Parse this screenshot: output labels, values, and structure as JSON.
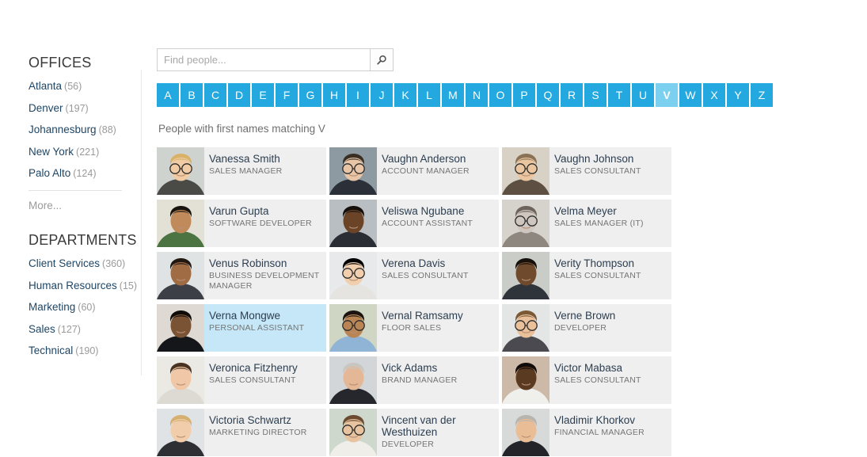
{
  "sidebar": {
    "offices": {
      "heading": "OFFICES",
      "items": [
        {
          "label": "Atlanta",
          "count": "(56)"
        },
        {
          "label": "Denver",
          "count": "(197)"
        },
        {
          "label": "Johannesburg",
          "count": "(88)"
        },
        {
          "label": "New York",
          "count": "(221)"
        },
        {
          "label": "Palo Alto",
          "count": "(124)"
        }
      ],
      "more_label": "More..."
    },
    "departments": {
      "heading": "DEPARTMENTS",
      "items": [
        {
          "label": "Client Services",
          "count": "(360)"
        },
        {
          "label": "Human Resources",
          "count": "(15)"
        },
        {
          "label": "Marketing",
          "count": "(60)"
        },
        {
          "label": "Sales",
          "count": "(127)"
        },
        {
          "label": "Technical",
          "count": "(190)"
        }
      ]
    }
  },
  "search": {
    "placeholder": "Find people...",
    "value": "",
    "icon": "search-icon"
  },
  "alphabet": {
    "letters": [
      "A",
      "B",
      "C",
      "D",
      "E",
      "F",
      "G",
      "H",
      "I",
      "J",
      "K",
      "L",
      "M",
      "N",
      "O",
      "P",
      "Q",
      "R",
      "S",
      "T",
      "U",
      "V",
      "W",
      "X",
      "Y",
      "Z"
    ],
    "active": "V"
  },
  "results": {
    "caption": "People with first names matching V",
    "people": [
      {
        "name": "Vanessa Smith",
        "title": "SALES MANAGER",
        "selected": false,
        "photo": {
          "skin": "#f0cba4",
          "hair": "#d8b268",
          "shirt": "#4a4a46",
          "bg": "#cfd3d0",
          "glasses": true
        }
      },
      {
        "name": "Vaughn Anderson",
        "title": "ACCOUNT MANAGER",
        "selected": false,
        "photo": {
          "skin": "#e8c5a6",
          "hair": "#3a2f25",
          "shirt": "#2b2f38",
          "bg": "#8e9aa2",
          "glasses": true
        }
      },
      {
        "name": "Vaughn Johnson",
        "title": "SALES CONSULTANT",
        "selected": false,
        "photo": {
          "skin": "#eac6a0",
          "hair": "#8a7256",
          "shirt": "#5d5043",
          "bg": "#d8d2c6",
          "glasses": true
        }
      },
      {
        "name": "Varun Gupta",
        "title": "SOFTWARE DEVELOPER",
        "selected": false,
        "photo": {
          "skin": "#c08a5a",
          "hair": "#19130f",
          "shirt": "#4c7342",
          "bg": "#e3e0d6",
          "glasses": false
        }
      },
      {
        "name": "Veliswa Ngubane",
        "title": "ACCOUNT ASSISTANT",
        "selected": false,
        "photo": {
          "skin": "#6b4428",
          "hair": "#16100c",
          "shirt": "#2a2d34",
          "bg": "#b9bec2",
          "glasses": false
        }
      },
      {
        "name": "Velma Meyer",
        "title": "SALES MANAGER (IT)",
        "selected": false,
        "photo": {
          "skin": "#cfc7bf",
          "hair": "#6d655d",
          "shirt": "#8d8780",
          "bg": "#d6d2cc",
          "glasses": true
        }
      },
      {
        "name": "Venus Robinson",
        "title": "BUSINESS DEVELOPMENT MANAGER",
        "selected": false,
        "photo": {
          "skin": "#a06c44",
          "hair": "#221812",
          "shirt": "#3c3f46",
          "bg": "#dfe3e4",
          "glasses": false
        }
      },
      {
        "name": "Verena Davis",
        "title": "SALES CONSULTANT",
        "selected": false,
        "photo": {
          "skin": "#f1cfae",
          "hair": "#cda householder",
          "shirt": "#e6e4e0",
          "bg": "#e7e9ea",
          "glasses": true
        }
      },
      {
        "name": "Verity Thompson",
        "title": "SALES CONSULTANT",
        "selected": false,
        "photo": {
          "skin": "#6f4a2c",
          "hair": "#17110d",
          "shirt": "#2f333a",
          "bg": "#c9ccc7",
          "glasses": false
        }
      },
      {
        "name": "Verna Mongwe",
        "title": "PERSONAL ASSISTANT",
        "selected": true,
        "photo": {
          "skin": "#7a5234",
          "hair": "#100c09",
          "shirt": "#15161a",
          "bg": "#ded9d2",
          "glasses": false
        }
      },
      {
        "name": "Vernal Ramsamy",
        "title": "FLOOR SALES",
        "selected": false,
        "photo": {
          "skin": "#b98555",
          "hair": "#1b1410",
          "shirt": "#8fb4d6",
          "bg": "#cfd6c4",
          "glasses": true
        }
      },
      {
        "name": "Verne Brown",
        "title": "DEVELOPER",
        "selected": false,
        "photo": {
          "skin": "#e9c09a",
          "hair": "#7a5a36",
          "shirt": "#4a4a50",
          "bg": "#e4e6e5",
          "glasses": true
        }
      },
      {
        "name": "Veronica Fitzhenry",
        "title": "SALES CONSULTANT",
        "selected": false,
        "photo": {
          "skin": "#f0c8a8",
          "hair": "#4a3222",
          "shirt": "#dddad4",
          "bg": "#ebe9e4",
          "glasses": false
        }
      },
      {
        "name": "Vick Adams",
        "title": "BRAND MANAGER",
        "selected": false,
        "photo": {
          "skin": "#e4b896",
          "hair": "#c9c6c2",
          "shirt": "#26272c",
          "bg": "#d3d6d8",
          "glasses": false
        }
      },
      {
        "name": "Victor Mabasa",
        "title": "SALES CONSULTANT",
        "selected": false,
        "photo": {
          "skin": "#5b3a22",
          "hair": "#120d09",
          "shirt": "#efefec",
          "bg": "#cdb9a8",
          "glasses": false
        }
      },
      {
        "name": "Victoria Schwartz",
        "title": "MARKETING DIRECTOR",
        "selected": false,
        "photo": {
          "skin": "#f2cdab",
          "hair": "#d6b070",
          "shirt": "#2d2f34",
          "bg": "#dfe3e6",
          "glasses": false
        }
      },
      {
        "name": "Vincent van der Westhuizen",
        "title": "DEVELOPER",
        "selected": false,
        "photo": {
          "skin": "#e8c3a0",
          "hair": "#6b4c30",
          "shirt": "#f0eee9",
          "bg": "#cfd8cc",
          "glasses": true
        }
      },
      {
        "name": "Vladimir Khorkov",
        "title": "FINANCIAL MANAGER",
        "selected": false,
        "photo": {
          "skin": "#e9bd95",
          "hair": "#b8b4ae",
          "shirt": "#23242a",
          "bg": "#d8dad9",
          "glasses": false
        }
      }
    ]
  },
  "colors": {
    "tile": "#23a8e0",
    "tile_active": "#7bd0ef",
    "card_bg": "#efefef",
    "card_selected": "#c5e7f7",
    "link": "#1e4666",
    "muted": "#9a9a9a"
  }
}
